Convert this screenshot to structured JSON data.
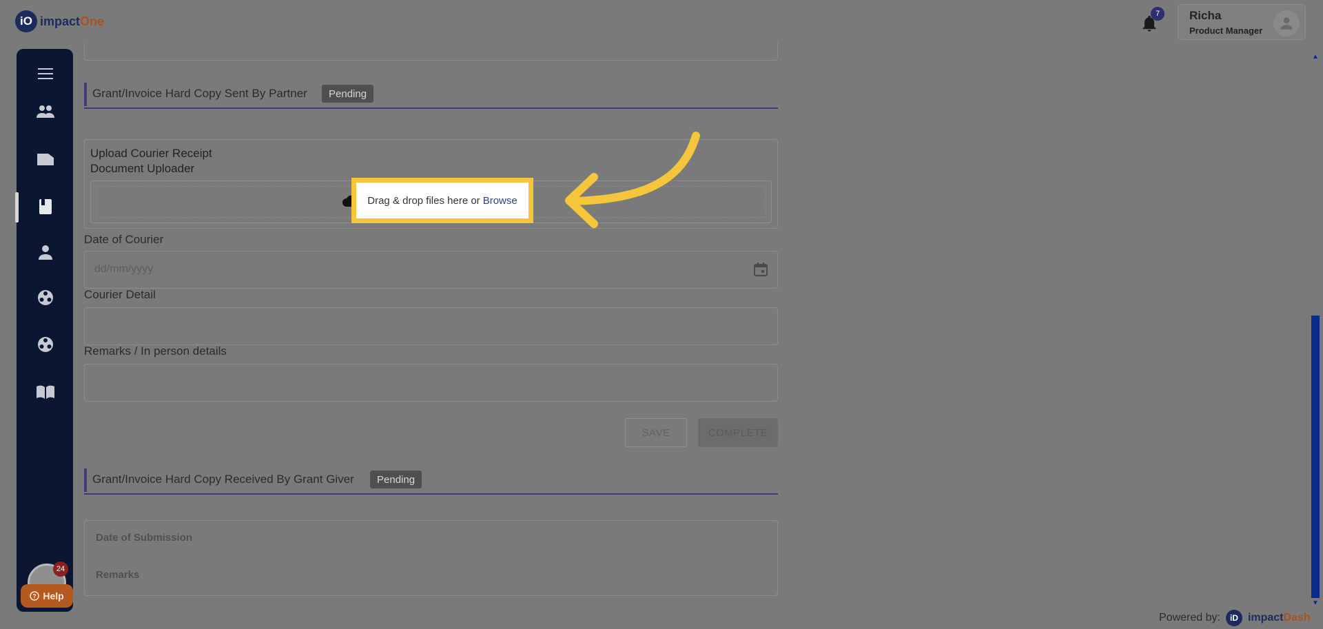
{
  "header": {
    "logo_mark": "iO",
    "logo_text_main": "impact",
    "logo_text_accent": "One",
    "notification_count": "7",
    "user_name": "Richa",
    "user_role": "Product Manager"
  },
  "sidebar": {
    "items": [
      {
        "icon": "menu-icon"
      },
      {
        "icon": "people-icon"
      },
      {
        "icon": "folder-icon"
      },
      {
        "icon": "book-icon"
      },
      {
        "icon": "person-icon"
      },
      {
        "icon": "film-reel-icon"
      },
      {
        "icon": "film-reel-icon"
      },
      {
        "icon": "open-book-icon"
      }
    ],
    "chat_badge": "24",
    "help_label": "Help"
  },
  "section1": {
    "title": "Grant/Invoice Hard Copy Sent By Partner",
    "status": "Pending",
    "upload_title": "Upload Courier Receipt",
    "uploader_label": "Document Uploader",
    "drop_text": "Drag & drop files here or",
    "browse_label": "Browse",
    "date_label": "Date of Courier",
    "date_placeholder": "dd/mm/yyyy",
    "courier_label": "Courier Detail",
    "remarks_label": "Remarks / In person details",
    "save_label": "SAVE",
    "complete_label": "COMPLETE"
  },
  "section2": {
    "title": "Grant/Invoice Hard Copy Received By Grant Giver",
    "status": "Pending",
    "submission_label": "Date of Submission",
    "remarks_label": "Remarks"
  },
  "footer": {
    "powered_by": "Powered by:",
    "brand_mark": "iD",
    "brand_main": "impact",
    "brand_accent": "Dash"
  },
  "colors": {
    "highlight": "#f5c63b",
    "sidebar_bg": "#0b1633",
    "accent": "#3e3a7a"
  }
}
